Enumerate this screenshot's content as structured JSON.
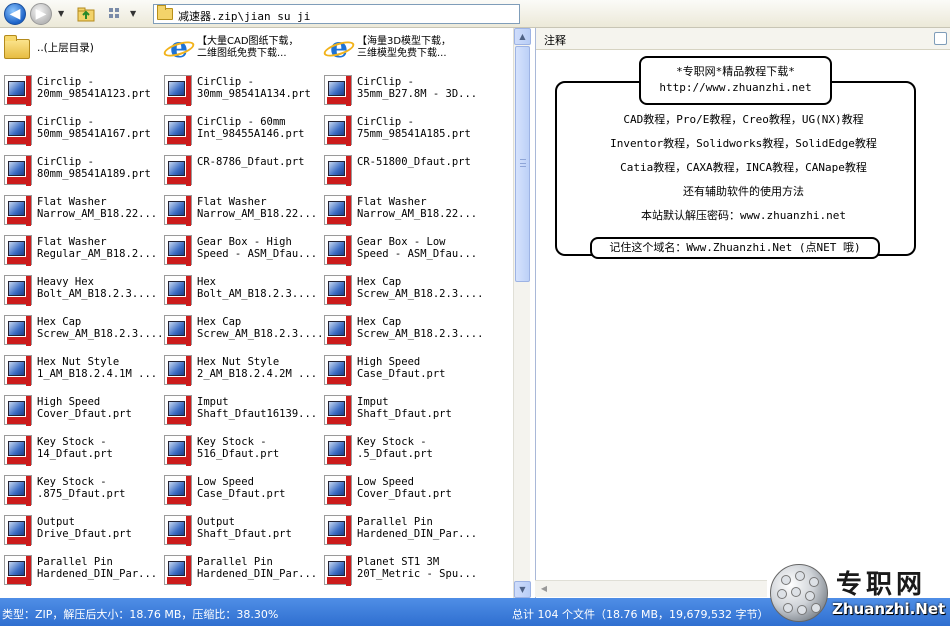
{
  "toolbar": {
    "address_path": "减速器.zip\\jian su ji"
  },
  "files": [
    {
      "name": "..(上层目录)",
      "icon": "up-folder-icon",
      "type": "folder"
    },
    {
      "name": "【大量CAD图纸下载，\n二维图纸免费下载...",
      "icon": "ie-icon",
      "type": "link"
    },
    {
      "name": "【海量3D模型下载，\n三维模型免费下载...",
      "icon": "ie-icon",
      "type": "link"
    },
    {
      "name": "Circlip -\n20mm_98541A123.prt",
      "icon": "prt-file-icon",
      "type": "file"
    },
    {
      "name": "CirClip -\n30mm_98541A134.prt",
      "icon": "prt-file-icon",
      "type": "file"
    },
    {
      "name": "CirClip -\n35mm_B27.8M - 3D...",
      "icon": "prt-file-icon",
      "type": "file"
    },
    {
      "name": "CirClip -\n50mm_98541A167.prt",
      "icon": "prt-file-icon",
      "type": "file"
    },
    {
      "name": "CirClip - 60mm\nInt_98455A146.prt",
      "icon": "prt-file-icon",
      "type": "file"
    },
    {
      "name": "CirClip -\n75mm_98541A185.prt",
      "icon": "prt-file-icon",
      "type": "file"
    },
    {
      "name": "CirClip -\n80mm_98541A189.prt",
      "icon": "prt-file-icon",
      "type": "file"
    },
    {
      "name": "CR-8786_Dfaut.prt",
      "icon": "prt-file-icon",
      "type": "file"
    },
    {
      "name": "CR-51800_Dfaut.prt",
      "icon": "prt-file-icon",
      "type": "file"
    },
    {
      "name": "Flat Washer\nNarrow_AM_B18.22...",
      "icon": "prt-file-icon",
      "type": "file"
    },
    {
      "name": "Flat Washer\nNarrow_AM_B18.22...",
      "icon": "prt-file-icon",
      "type": "file"
    },
    {
      "name": "Flat Washer\nNarrow_AM_B18.22...",
      "icon": "prt-file-icon",
      "type": "file"
    },
    {
      "name": "Flat Washer\nRegular_AM_B18.2...",
      "icon": "prt-file-icon",
      "type": "file"
    },
    {
      "name": "Gear Box - High\nSpeed - ASM_Dfau...",
      "icon": "prt-file-icon",
      "type": "file"
    },
    {
      "name": "Gear Box - Low\nSpeed - ASM_Dfau...",
      "icon": "prt-file-icon",
      "type": "file"
    },
    {
      "name": "Heavy Hex\nBolt_AM_B18.2.3....",
      "icon": "prt-file-icon",
      "type": "file"
    },
    {
      "name": "Hex\nBolt_AM_B18.2.3....",
      "icon": "prt-file-icon",
      "type": "file"
    },
    {
      "name": "Hex Cap\nScrew_AM_B18.2.3....",
      "icon": "prt-file-icon",
      "type": "file"
    },
    {
      "name": "Hex Cap\nScrew_AM_B18.2.3....",
      "icon": "prt-file-icon",
      "type": "file"
    },
    {
      "name": "Hex Cap\nScrew_AM_B18.2.3....",
      "icon": "prt-file-icon",
      "type": "file"
    },
    {
      "name": "Hex Cap\nScrew_AM_B18.2.3....",
      "icon": "prt-file-icon",
      "type": "file"
    },
    {
      "name": "Hex Nut Style\n1_AM_B18.2.4.1M ...",
      "icon": "prt-file-icon",
      "type": "file"
    },
    {
      "name": "Hex Nut Style\n2_AM_B18.2.4.2M ...",
      "icon": "prt-file-icon",
      "type": "file"
    },
    {
      "name": "High Speed\nCase_Dfaut.prt",
      "icon": "prt-file-icon",
      "type": "file"
    },
    {
      "name": "High Speed\nCover_Dfaut.prt",
      "icon": "prt-file-icon",
      "type": "file"
    },
    {
      "name": "Imput\nShaft_Dfaut16139...",
      "icon": "prt-file-icon",
      "type": "file"
    },
    {
      "name": "Imput\nShaft_Dfaut.prt",
      "icon": "prt-file-icon",
      "type": "file"
    },
    {
      "name": "Key Stock -\n14_Dfaut.prt",
      "icon": "prt-file-icon",
      "type": "file"
    },
    {
      "name": "Key Stock -\n516_Dfaut.prt",
      "icon": "prt-file-icon",
      "type": "file"
    },
    {
      "name": "Key Stock -\n.5_Dfaut.prt",
      "icon": "prt-file-icon",
      "type": "file"
    },
    {
      "name": "Key Stock -\n.875_Dfaut.prt",
      "icon": "prt-file-icon",
      "type": "file"
    },
    {
      "name": "Low Speed\nCase_Dfaut.prt",
      "icon": "prt-file-icon",
      "type": "file"
    },
    {
      "name": "Low Speed\nCover_Dfaut.prt",
      "icon": "prt-file-icon",
      "type": "file"
    },
    {
      "name": "Output\nDrive_Dfaut.prt",
      "icon": "prt-file-icon",
      "type": "file"
    },
    {
      "name": "Output\nShaft_Dfaut.prt",
      "icon": "prt-file-icon",
      "type": "file"
    },
    {
      "name": "Parallel Pin\nHardened_DIN_Par...",
      "icon": "prt-file-icon",
      "type": "file"
    },
    {
      "name": "Parallel Pin\nHardened_DIN_Par...",
      "icon": "prt-file-icon",
      "type": "file"
    },
    {
      "name": "Parallel Pin\nHardened_DIN_Par...",
      "icon": "prt-file-icon",
      "type": "file"
    },
    {
      "name": "Planet ST1 3M\n20T_Metric - Spu...",
      "icon": "prt-file-icon",
      "type": "file"
    }
  ],
  "notes": {
    "header": "注释",
    "banner_line1": "*专职网*精品教程下载*",
    "banner_line2": "http://www.zhuanzhi.net",
    "lines": [
      "CAD教程，Pro/E教程，Creo教程，UG(NX)教程",
      "Inventor教程，Solidworks教程，SolidEdge教程",
      "Catia教程，CAXA教程，INCA教程，CANape教程",
      "还有辅助软件的使用方法",
      "本站默认解压密码：www.zhuanzhi.net"
    ],
    "remember": "记住这个域名：Www.Zhuanzhi.Net (点NET 哦)"
  },
  "status": {
    "left": "类型：ZIP，解压后大小：18.76 MB，压缩比：38.30%",
    "right": "总计 104 个文件（18.76 MB，19,679,532 字节）"
  },
  "watermark": {
    "cn": "专职网",
    "en": "Zhuanzhi.Net"
  }
}
